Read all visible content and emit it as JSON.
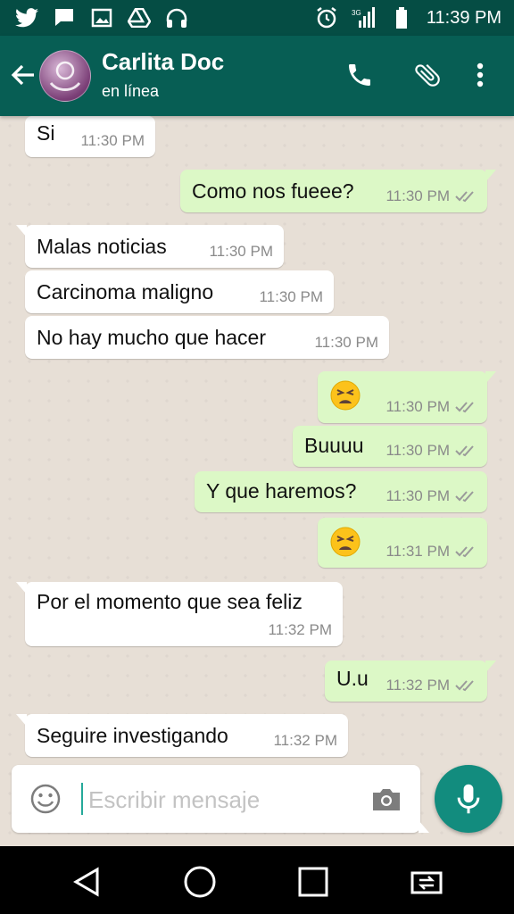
{
  "status_bar": {
    "time": "11:39 PM",
    "left_icons": [
      "twitter-icon",
      "chat-notification-icon",
      "image-icon",
      "drive-icon",
      "headset-icon"
    ],
    "right_icons": [
      "alarm-icon",
      "signal-3g-icon",
      "battery-icon"
    ]
  },
  "header": {
    "contact_name": "Carlita Doc",
    "status": "en línea",
    "actions": [
      "call-icon",
      "attach-icon",
      "more-icon"
    ]
  },
  "messages": [
    {
      "dir": "in",
      "text": "Si",
      "time": "11:30 PM"
    },
    {
      "dir": "out",
      "text": "Como nos fueee?",
      "time": "11:30 PM"
    },
    {
      "dir": "in",
      "text": "Malas noticias",
      "time": "11:30 PM"
    },
    {
      "dir": "in",
      "text": "Carcinoma maligno",
      "time": "11:30 PM"
    },
    {
      "dir": "in",
      "text": "No hay mucho que hacer",
      "time": "11:30 PM"
    },
    {
      "dir": "out",
      "emoji": "tired-face-emoji",
      "time": "11:30 PM"
    },
    {
      "dir": "out",
      "text": "Buuuu",
      "time": "11:30 PM"
    },
    {
      "dir": "out",
      "text": "Y que haremos?",
      "time": "11:30 PM"
    },
    {
      "dir": "out",
      "emoji": "tired-face-emoji",
      "time": "11:31 PM"
    },
    {
      "dir": "in",
      "text": "Por el momento que sea feliz",
      "time": "11:32 PM"
    },
    {
      "dir": "out",
      "text": "U.u",
      "time": "11:32 PM"
    },
    {
      "dir": "in",
      "text": "Seguire investigando",
      "time": "11:32 PM"
    }
  ],
  "composer": {
    "placeholder": "Escribir mensaje",
    "value": ""
  },
  "colors": {
    "header": "#075e54",
    "status_bar": "#054d44",
    "outgoing_bubble": "#dcf8c6",
    "incoming_bubble": "#ffffff",
    "mic_button": "#128c7e"
  }
}
